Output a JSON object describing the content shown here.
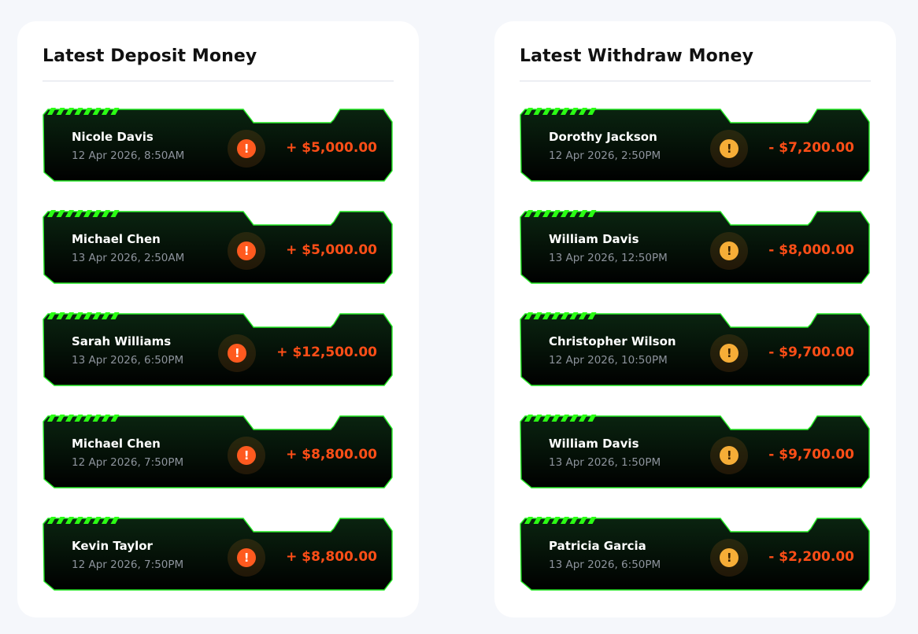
{
  "deposit": {
    "title": "Latest Deposit Money",
    "items": [
      {
        "name": "Nicole Davis",
        "date": "12 Apr 2026, 8:50AM",
        "amount": "+ $5,000.00"
      },
      {
        "name": "Michael Chen",
        "date": "13 Apr 2026, 2:50AM",
        "amount": "+ $5,000.00"
      },
      {
        "name": "Sarah Williams",
        "date": "13 Apr 2026, 6:50PM",
        "amount": "+ $12,500.00"
      },
      {
        "name": "Michael Chen",
        "date": "12 Apr 2026, 7:50PM",
        "amount": "+ $8,800.00"
      },
      {
        "name": "Kevin Taylor",
        "date": "12 Apr 2026, 7:50PM",
        "amount": "+ $8,800.00"
      }
    ]
  },
  "withdraw": {
    "title": "Latest Withdraw Money",
    "items": [
      {
        "name": "Dorothy Jackson",
        "date": "12 Apr 2026, 2:50PM",
        "amount": "- $7,200.00"
      },
      {
        "name": "William Davis",
        "date": "13 Apr 2026, 12:50PM",
        "amount": "- $8,000.00"
      },
      {
        "name": "Christopher Wilson",
        "date": "12 Apr 2026, 10:50PM",
        "amount": "- $9,700.00"
      },
      {
        "name": "William Davis",
        "date": "13 Apr 2026, 1:50PM",
        "amount": "- $9,700.00"
      },
      {
        "name": "Patricia Garcia",
        "date": "13 Apr 2026, 6:50PM",
        "amount": "- $2,200.00"
      }
    ]
  },
  "icons": {
    "alert": "exclamation-icon",
    "alert_glyph": "!"
  },
  "colors": {
    "card_bg_top": "#0a2410",
    "card_bg_bottom": "#000000",
    "card_border": "#22e822",
    "amount": "#ff4e17",
    "deposit_alert": "#ff5a1f",
    "withdraw_alert": "#f6ad37"
  }
}
